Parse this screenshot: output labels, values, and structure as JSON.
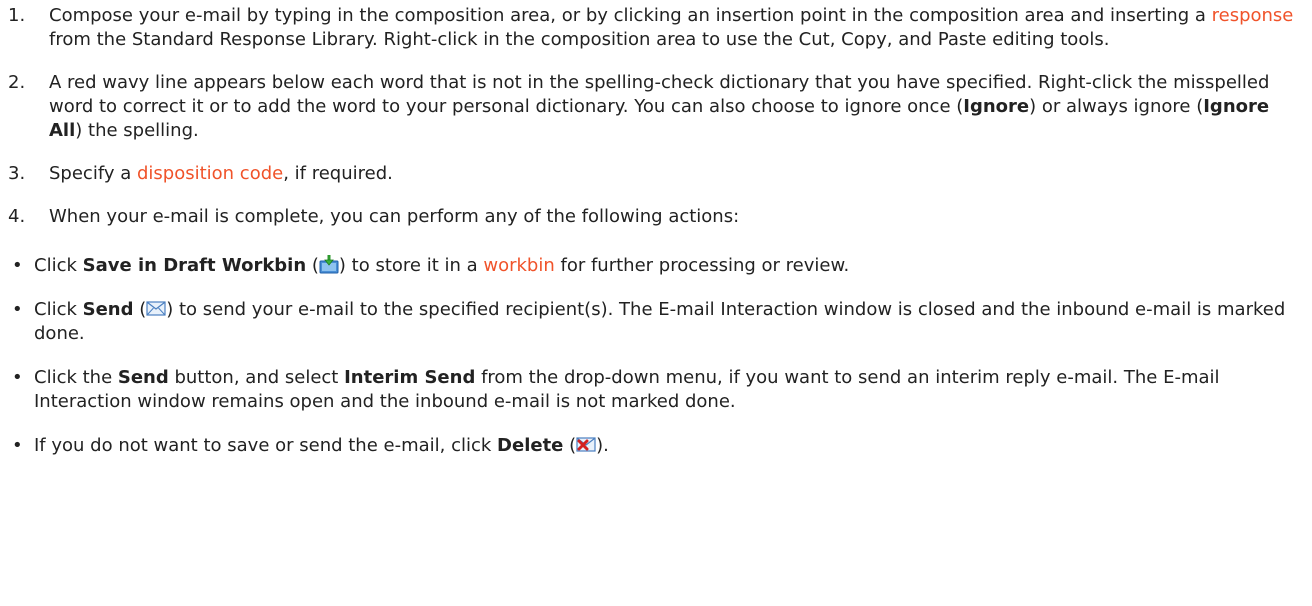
{
  "steps": [
    {
      "number": "1.",
      "text_a": "Compose your e-mail by typing in the composition area, or by clicking an insertion point in the composition area and inserting a ",
      "link": "response",
      "text_b": " from the Standard Response Library. Right-click in the composition area to use the Cut, Copy, and Paste editing tools."
    },
    {
      "number": "2.",
      "text_a": "A red wavy line appears below each word that is not in the spelling-check dictionary that you have specified. Right-click the misspelled word to correct it or to add the word to your personal dictionary. You can also choose to ignore once (",
      "bold_a": "Ignore",
      "text_b": ") or always ignore (",
      "bold_b": "Ignore All",
      "text_c": ") the spelling."
    },
    {
      "number": "3.",
      "text_a": "Specify a ",
      "link": "disposition code",
      "text_b": ", if required."
    },
    {
      "number": "4.",
      "text_a": "When your e-mail is complete, you can perform any of the following actions:"
    }
  ],
  "bullets": [
    {
      "pre": "Click ",
      "bold": "Save in Draft Workbin",
      "paren_open": " (",
      "icon": "save-to-workbin-icon",
      "paren_close": ") to store it in a ",
      "link": "workbin",
      "post": " for further processing or review."
    },
    {
      "pre": "Click ",
      "bold": "Send",
      "paren_open": " (",
      "icon": "send-envelope-icon",
      "post": ") to send your e-mail to the specified recipient(s). The E-mail Interaction window is closed and the inbound e-mail is marked done."
    },
    {
      "pre": "Click the ",
      "bold": "Send",
      "mid": " button, and select ",
      "bold_b": "Interim Send",
      "post": " from the drop-down menu, if you want to send an interim reply e-mail. The E-mail Interaction window remains open and the inbound e-mail is not marked done."
    },
    {
      "pre": "If you do not want to save or send the e-mail, click ",
      "bold": "Delete",
      "paren_open": " (",
      "icon": "delete-email-icon",
      "post": ")."
    }
  ],
  "bullet_char": "•",
  "colors": {
    "link": "#f0532a",
    "text": "#222222"
  }
}
